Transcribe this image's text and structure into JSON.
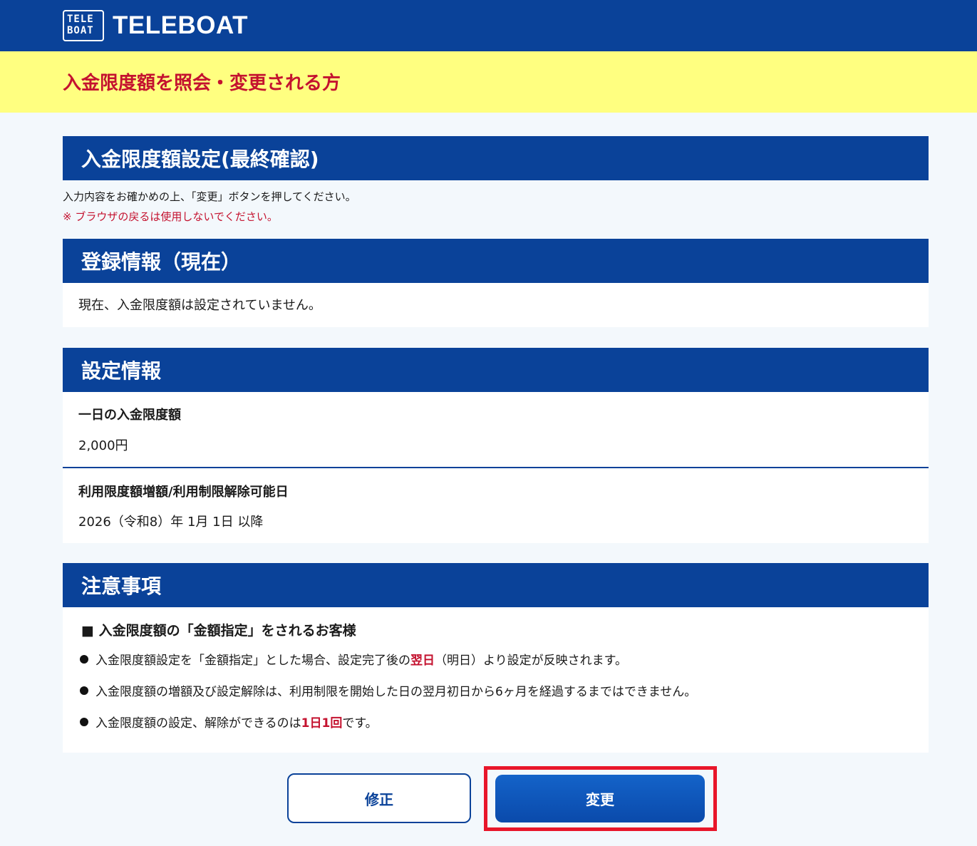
{
  "header": {
    "logo_box_line1": "TELE",
    "logo_box_line2": "BOAT",
    "logo_text": "TELEBOAT"
  },
  "banner": {
    "title": "入金限度額を照会・変更される方"
  },
  "confirm": {
    "title": "入金限度額設定(最終確認)",
    "instruction": "入力内容をお確かめの上、「変更」ボタンを押してください。",
    "warning": "※ ブラウザの戻るは使用しないでください。"
  },
  "current_info": {
    "title": "登録情報（現在）",
    "text": "現在、入金限度額は設定されていません。"
  },
  "settings": {
    "title": "設定情報",
    "daily_limit_label": "一日の入金限度額",
    "daily_limit_value": "2,000円",
    "release_label": "利用限度額増額/利用制限解除可能日",
    "release_value": "2026（令和8）年 1月 1日 以降"
  },
  "notes": {
    "title": "注意事項",
    "subheading": "■ 入金限度額の「金額指定」をされるお客様",
    "bullet1_pre": "入金限度額設定を「金額指定」とした場合、設定完了後の",
    "bullet1_em": "翌日",
    "bullet1_post": "（明日）より設定が反映されます。",
    "bullet2": "入金限度額の増額及び設定解除は、利用制限を開始した日の翌月初日から6ヶ月を経過するまではできません。",
    "bullet3_pre": "入金限度額の設定、解除ができるのは",
    "bullet3_em": "1日1回",
    "bullet3_post": "です。"
  },
  "buttons": {
    "fix_label": "修正",
    "change_label": "変更"
  },
  "colors": {
    "brand_blue": "#0a4299",
    "banner_yellow": "#ffff80",
    "alert_red": "#c4122f",
    "highlight_red": "#e8162a"
  }
}
